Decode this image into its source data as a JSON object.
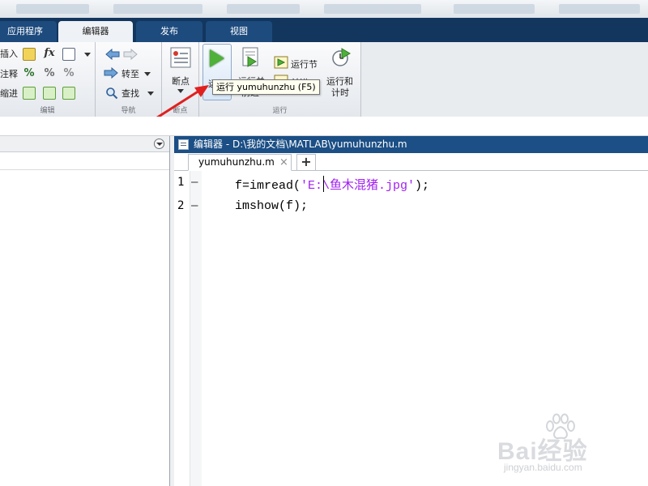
{
  "tabs": [
    {
      "label": "应用程序",
      "active": false
    },
    {
      "label": "编辑器",
      "active": true
    },
    {
      "label": "发布",
      "active": false
    },
    {
      "label": "视图",
      "active": false
    }
  ],
  "ribbon": {
    "edit_group": {
      "label": "编辑",
      "insert": "插入",
      "comment": "注释",
      "indent": "缩进",
      "fx_icon": "fx"
    },
    "nav_group": {
      "label": "导航",
      "goto": "转至",
      "find": "查找"
    },
    "breakpoint_group": {
      "label": "断点",
      "breakpoints": "断点"
    },
    "run_group": {
      "label": "运行",
      "run": "运行",
      "run_advance": "运行并",
      "run_advance_2": "前进",
      "run_section": "运行节",
      "advance": "前进",
      "run_time": "运行和",
      "run_time_2": "计时"
    }
  },
  "tooltip": "运行 yumuhunzhu (F5)",
  "editor": {
    "title": "编辑器 - D:\\我的文档\\MATLAB\\yumuhunzhu.m",
    "file_tab": "yumuhunzhu.m",
    "close_glyph": "×",
    "new_tab_glyph": "+",
    "lines": [
      {
        "number": "1",
        "marker": "—",
        "code_pre": "f=imread(",
        "code_str": "'E:\\鱼木混猪.jpg'",
        "code_post": ");"
      },
      {
        "number": "2",
        "marker": "—",
        "code_pre": "imshow(f);",
        "code_str": "",
        "code_post": ""
      }
    ]
  },
  "watermark": {
    "brand": "Bai经验",
    "url": "jingyan.baidu.com"
  },
  "colors": {
    "tab_strip": "#12365e",
    "editor_title_bar": "#1b4f85",
    "string_literal": "#a020f0",
    "annotation_arrow": "#e02020"
  }
}
